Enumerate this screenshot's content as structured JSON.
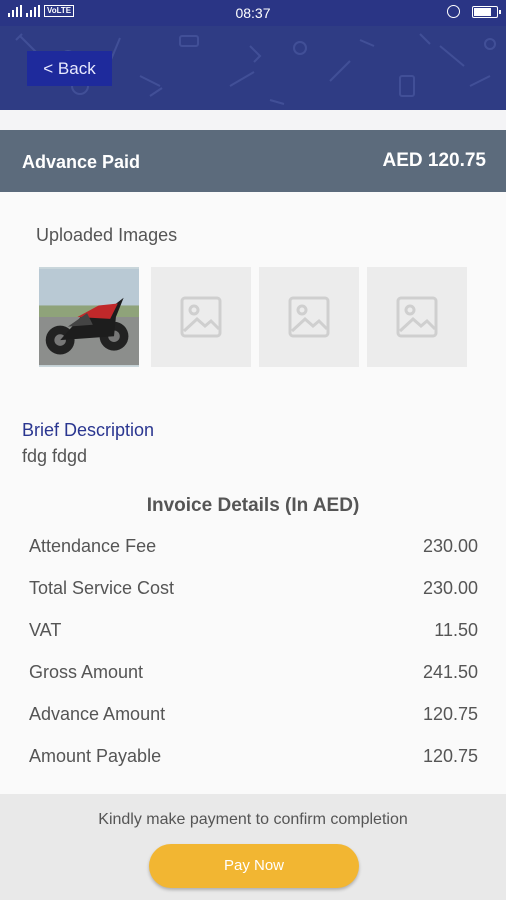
{
  "status_bar": {
    "network_badge": "VoLTE",
    "time": "08:37",
    "icons": [
      "signal-icon",
      "signal-icon",
      "alarm-icon",
      "battery-icon"
    ]
  },
  "header": {
    "back_label": "< Back",
    "background_color": "#2f3c84"
  },
  "advance": {
    "label": "Advance Paid",
    "amount": "AED 120.75"
  },
  "uploaded_images": {
    "title": "Uploaded Images",
    "items": [
      {
        "type": "photo",
        "icon": "motorcycle-photo"
      },
      {
        "type": "placeholder",
        "icon": "image-placeholder-icon"
      },
      {
        "type": "placeholder",
        "icon": "image-placeholder-icon"
      },
      {
        "type": "placeholder",
        "icon": "image-placeholder-icon"
      }
    ]
  },
  "description": {
    "title": "Brief Description",
    "text": "fdg fdgd"
  },
  "invoice": {
    "title": "Invoice Details (In AED)",
    "rows": [
      {
        "label": "Attendance Fee",
        "value": "230.00"
      },
      {
        "label": "Total Service Cost",
        "value": "230.00"
      },
      {
        "label": "VAT",
        "value": "11.50"
      },
      {
        "label": "Gross Amount",
        "value": "241.50"
      },
      {
        "label": "Advance Amount",
        "value": "120.75"
      },
      {
        "label": "Amount Payable",
        "value": "120.75"
      }
    ]
  },
  "footer": {
    "note": "Kindly make payment to confirm completion",
    "pay_label": "Pay Now",
    "pay_color": "#f2b632"
  }
}
